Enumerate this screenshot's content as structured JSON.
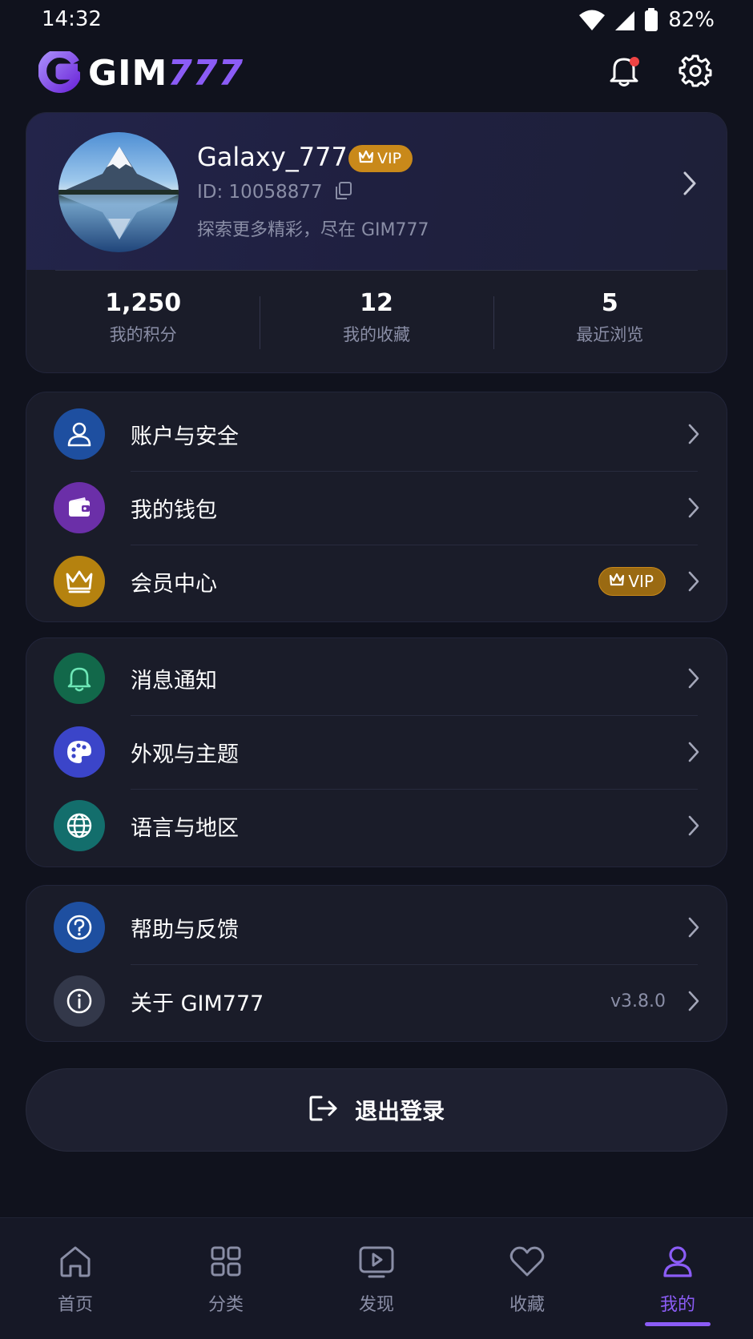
{
  "status_bar": {
    "time": "14:32",
    "battery": "82%"
  },
  "header": {
    "logo_main": "GIM",
    "logo_accent": "777"
  },
  "profile": {
    "username": "Galaxy_777",
    "vip_label": "VIP",
    "user_id": "ID: 10058877",
    "tagline": "探索更多精彩，尽在 GIM777"
  },
  "stats": [
    {
      "value": "1,250",
      "label": "我的积分"
    },
    {
      "value": "12",
      "label": "我的收藏"
    },
    {
      "value": "5",
      "label": "最近浏览"
    }
  ],
  "menu_group_1": [
    {
      "label": "账户与安全",
      "icon": "user-icon",
      "color": "#1e4fa0"
    },
    {
      "label": "我的钱包",
      "icon": "wallet-icon",
      "color": "#6b2fa8"
    },
    {
      "label": "会员中心",
      "icon": "crown-icon",
      "color": "#b5820f",
      "badge": "VIP"
    }
  ],
  "menu_group_2": [
    {
      "label": "消息通知",
      "icon": "bell-icon",
      "color": "#12684a"
    },
    {
      "label": "外观与主题",
      "icon": "palette-icon",
      "color": "#3b45c9"
    },
    {
      "label": "语言与地区",
      "icon": "globe-icon",
      "color": "#136e6c"
    }
  ],
  "menu_group_3": [
    {
      "label": "帮助与反馈",
      "icon": "help-icon",
      "color": "#1e4fa0"
    },
    {
      "label": "关于 GIM777",
      "icon": "info-icon",
      "color": "#33384a",
      "version": "v3.8.0"
    }
  ],
  "logout": {
    "label": "退出登录"
  },
  "tabs": [
    {
      "label": "首页",
      "icon": "home-icon"
    },
    {
      "label": "分类",
      "icon": "grid-icon"
    },
    {
      "label": "发现",
      "icon": "play-icon"
    },
    {
      "label": "收藏",
      "icon": "heart-icon"
    },
    {
      "label": "我的",
      "icon": "profile-icon",
      "active": true
    }
  ],
  "colors": {
    "accent": "#8b5cf6",
    "vip_gold": "#c9891a",
    "background": "#10121d",
    "card": "#1a1c29"
  }
}
